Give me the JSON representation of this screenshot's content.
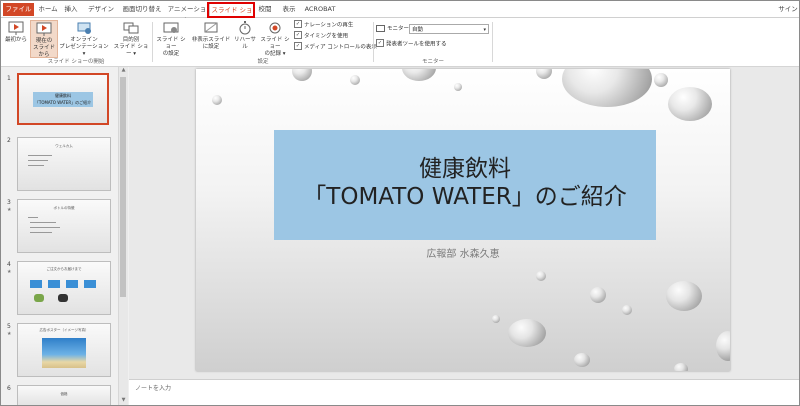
{
  "tabs": [
    "ファイル",
    "ホーム",
    "挿入",
    "デザイン",
    "画面切り替え",
    "アニメーション",
    "スライド ショー",
    "校閲",
    "表示",
    "ACROBAT"
  ],
  "signin": "サイン",
  "ribbon": {
    "from_beginning": "最初から",
    "from_current": [
      "現在の",
      "スライドから"
    ],
    "online_presentation": [
      "オンライン",
      "プレゼンテーション ▾"
    ],
    "custom_show": [
      "目的別",
      "スライド ショー ▾"
    ],
    "group_start": "スライド ショーの開始",
    "setup_show": [
      "スライド ショー",
      "の設定"
    ],
    "hide_slide": [
      "非表示スライド",
      "に設定"
    ],
    "rehearse": "リハーサル",
    "record": [
      "スライド ショー",
      "の記録 ▾"
    ],
    "play_narrations": "ナレーションの再生",
    "use_timings": "タイミングを使用",
    "show_media_controls": "メディア コントロールの表示",
    "group_setup": "設定",
    "monitor_label": "モニター:",
    "monitor_value": "自動",
    "use_presenter_view": "発表者ツールを使用する",
    "group_monitors": "モニター"
  },
  "thumbnails": [
    {
      "num": "1",
      "title": "健康飲料",
      "title2": "「TOMATO WATER」のご紹介"
    },
    {
      "num": "2",
      "title": "ウェルカム"
    },
    {
      "num": "3",
      "title": "ボトルの特徴"
    },
    {
      "num": "4",
      "title": "ご注文からお届けまで"
    },
    {
      "num": "5",
      "title": "広告ポスター（イメージ写真）"
    },
    {
      "num": "6",
      "title": "価格"
    }
  ],
  "slide": {
    "title_line1": "健康飲料",
    "title_line2": "「TOMATO WATER」のご紹介",
    "subtitle": "広報部 水森久恵"
  },
  "notes_placeholder": "ノートを入力"
}
